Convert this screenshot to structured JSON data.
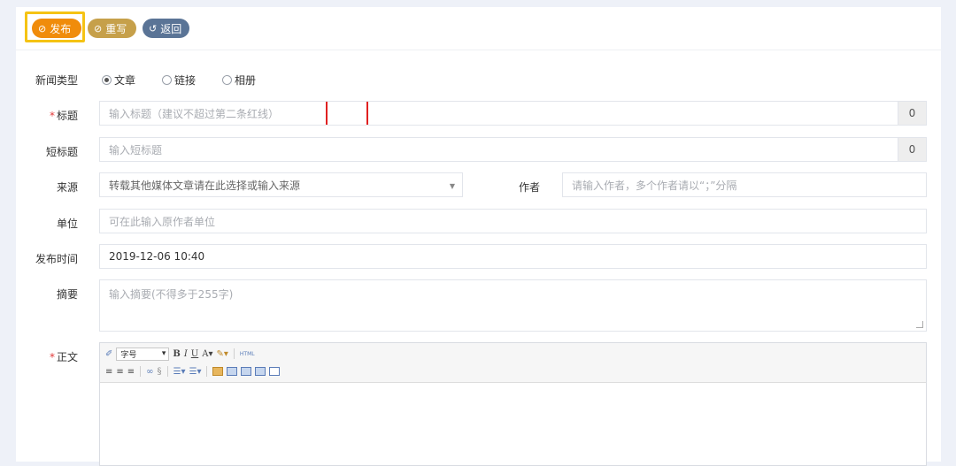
{
  "toolbar": {
    "publish_label": "发布",
    "rewrite_label": "重写",
    "back_label": "返回"
  },
  "form": {
    "news_type": {
      "label": "新闻类型",
      "options": [
        "文章",
        "链接",
        "相册"
      ],
      "selected": "文章"
    },
    "title": {
      "required_mark": "*",
      "label": "标题",
      "placeholder": "输入标题（建议不超过第二条红线）",
      "count": "0"
    },
    "short_title": {
      "label": "短标题",
      "placeholder": "输入短标题",
      "count": "0"
    },
    "source": {
      "label": "来源",
      "placeholder": "转载其他媒体文章请在此选择或输入来源"
    },
    "author": {
      "label": "作者",
      "placeholder": "请输入作者，多个作者请以“；”分隔"
    },
    "unit": {
      "label": "单位",
      "placeholder": "可在此输入原作者单位"
    },
    "publish_time": {
      "label": "发布时间",
      "value": "2019-12-06 10:40"
    },
    "summary": {
      "label": "摘要",
      "placeholder": "输入摘要(不得多于255字)"
    },
    "body": {
      "required_mark": "*",
      "label": "正文",
      "font_size_select": "字号",
      "html_label": "HTML"
    }
  },
  "colors": {
    "publish": "#f08c0b",
    "rewrite": "#c6a04a",
    "back": "#5a7496",
    "highlight": "#f5c314",
    "red_line": "#e02020"
  }
}
